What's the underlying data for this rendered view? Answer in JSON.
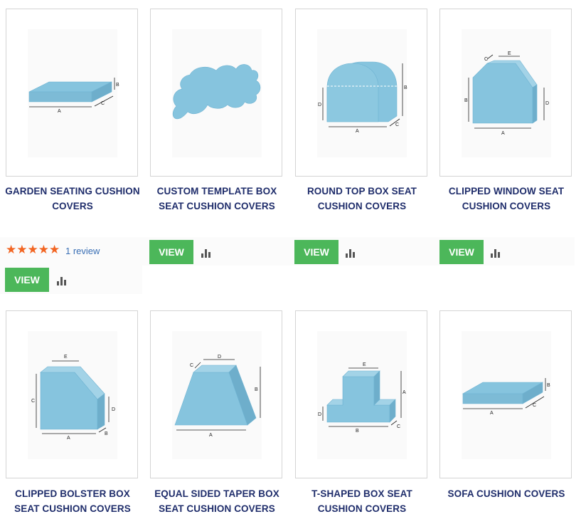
{
  "products": [
    {
      "title_line1": "GARDEN SEATING CUSHION",
      "title_line2": "COVERS",
      "icon": "flat-box-cushion-icon"
    },
    {
      "title_line1": "CUSTOM TEMPLATE BOX",
      "title_line2": "SEAT CUSHION COVERS",
      "icon": "custom-template-cushion-icon"
    },
    {
      "title_line1": "ROUND TOP BOX SEAT",
      "title_line2": "CUSHION COVERS",
      "icon": "round-top-box-cushion-icon"
    },
    {
      "title_line1": "CLIPPED WINDOW SEAT",
      "title_line2": "CUSHION COVERS",
      "icon": "clipped-window-seat-cushion-icon"
    },
    {
      "title_line1": "CLIPPED BOLSTER BOX",
      "title_line2": "SEAT CUSHION COVERS",
      "icon": "clipped-bolster-box-cushion-icon"
    },
    {
      "title_line1": "EQUAL SIDED TAPER BOX",
      "title_line2": "SEAT CUSHION COVERS",
      "icon": "taper-box-cushion-icon"
    },
    {
      "title_line1": "T-SHAPED BOX SEAT",
      "title_line2": "CUSHION COVERS",
      "icon": "t-shaped-box-cushion-icon"
    },
    {
      "title_line1": "SOFA CUSHION COVERS",
      "title_line2": "",
      "icon": "sofa-cushion-icon"
    }
  ],
  "rating": {
    "stars": "★★★★★",
    "rating_value": 5,
    "review_text": "1 review"
  },
  "buttons": {
    "view_label": "VIEW"
  },
  "dimension_labels": {
    "a": "A",
    "b": "B",
    "c": "C",
    "d": "D",
    "e": "E"
  },
  "colors": {
    "title": "#1f2d6b",
    "view_button": "#4cb75a",
    "star": "#f26522",
    "review_link": "#3a6fb5",
    "shape_fill": "#86c4de"
  }
}
